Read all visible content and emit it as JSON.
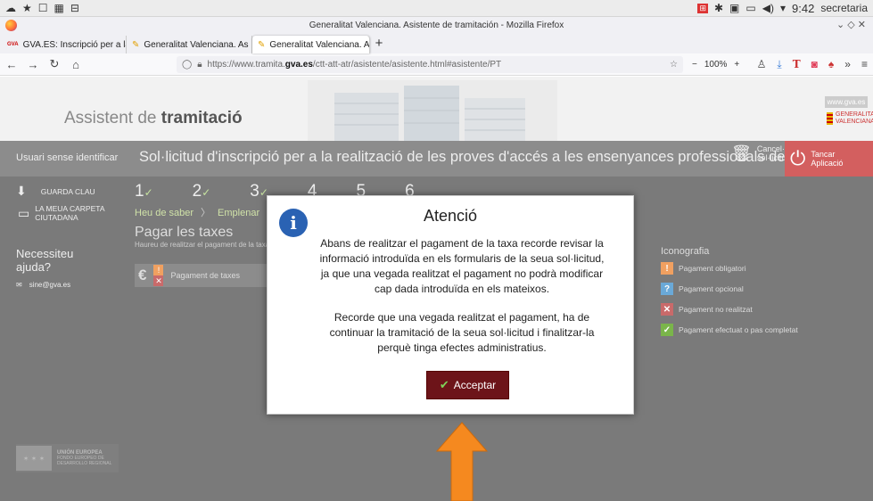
{
  "os": {
    "clock": "9:42",
    "user": "secretaria"
  },
  "window": {
    "title": "Generalitat Valenciana. Asistente de tramitación - Mozilla Firefox"
  },
  "tabs": [
    {
      "label": "GVA.ES: Inscripció per a la",
      "icon": "gva-icon"
    },
    {
      "label": "Generalitat Valenciana. As",
      "icon": "pencil-icon"
    },
    {
      "label": "Generalitat Valenciana. As",
      "icon": "pencil-icon",
      "active": true
    }
  ],
  "url": {
    "prefix": "https://www.tramita.",
    "host": "gva.es",
    "path": "/ctt-att-atr/asistente/asistente.html#asistente/PT"
  },
  "zoom": "100%",
  "site": {
    "brand_pre": "Assistent de ",
    "brand_bold": "tramitació",
    "gva_url": "www.gva.es",
    "gva_logo_text": "GENERALITAT VALENCIANA"
  },
  "header": {
    "user": "Usuari sense identificar",
    "procedure_title": "Sol·licitud d'inscripció per a la realització de les proves d'accés a les ensenyances professionals de música i dansa",
    "cancel_line1": "Cancel·lar",
    "cancel_line2": "sol·licitud",
    "close_line1": "Tancar",
    "close_line2": "Aplicació"
  },
  "sidebar": {
    "save_key": "GUARDA CLAU",
    "folder": "LA MEUA CARPETA CIUTADANA",
    "help": "Necessiteu ajuda?",
    "email": "sine@gva.es",
    "eu_line1": "UNIÓN EUROPEA",
    "eu_line2": "FONDO EUROPEO DE",
    "eu_line3": "DESARROLLO REGIONAL"
  },
  "steps": [
    {
      "num": "1",
      "done": true
    },
    {
      "num": "2",
      "done": true
    },
    {
      "num": "3",
      "done": true
    },
    {
      "num": "4",
      "done": false
    },
    {
      "num": "5",
      "done": false
    },
    {
      "num": "6",
      "done": false
    }
  ],
  "subnav": {
    "item1": "Heu de saber",
    "item2": "Emplenar"
  },
  "pay": {
    "title": "Pagar les taxes",
    "desc": "Haureu de realitzar el pagament de la taxa c",
    "row_label": "Pagament de taxes"
  },
  "legend": {
    "title": "Iconografia",
    "items": [
      {
        "label": "Pagament obligatori",
        "symbol": "!",
        "color": "#f0a060"
      },
      {
        "label": "Pagament opcional",
        "symbol": "?",
        "color": "#6aa9d8"
      },
      {
        "label": "Pagament no realitzat",
        "symbol": "✕",
        "color": "#c96a6a"
      },
      {
        "label": "Pagament efectuat o pas completat",
        "symbol": "✓",
        "color": "#7ab54a"
      }
    ]
  },
  "modal": {
    "title": "Atenció",
    "paragraph1": "Abans de realitzar el pagament de la taxa recorde revisar la informació introduïda en els formularis de la seua sol·licitud, ja que una vegada realitzat el pagament no podrà modificar cap dada introduïda en els mateixos.",
    "paragraph2": "Recorde que una vegada realitzat el pagament, ha de continuar la tramitació de la seua sol·licitud i finalitzar-la perquè tinga efectes administratius.",
    "accept": "Acceptar"
  },
  "colors": {
    "accept_bg": "#6d1419",
    "close_app_bg": "#d35f5f",
    "info_icon": "#2a62b3",
    "arrow": "#f5891f"
  }
}
